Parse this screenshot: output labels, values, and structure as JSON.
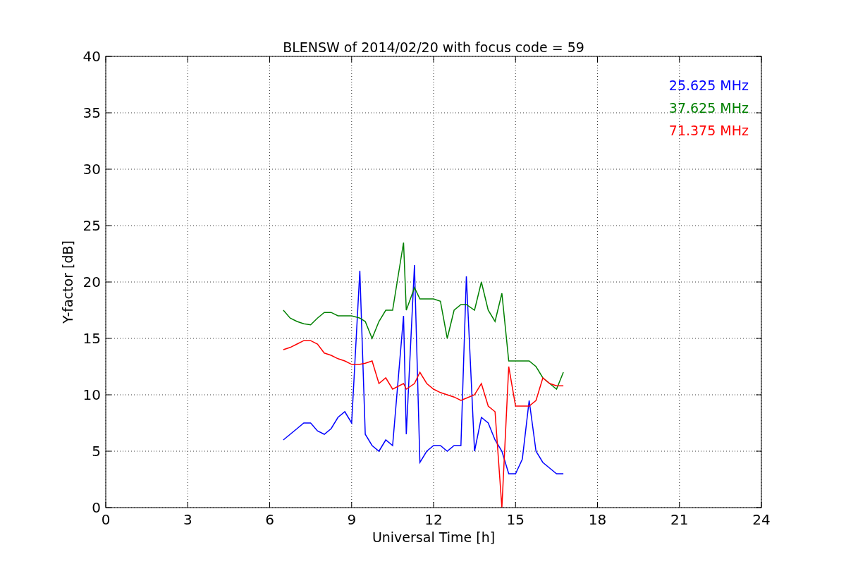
{
  "chart_data": {
    "type": "line",
    "title": "BLENSW of 2014/02/20 with focus code = 59",
    "xlabel": "Universal Time [h]",
    "ylabel": "Y-factor [dB]",
    "x": [
      6.5,
      6.75,
      7,
      7.25,
      7.5,
      7.75,
      8,
      8.25,
      8.5,
      8.75,
      9,
      9.3,
      9.5,
      9.75,
      10,
      10.25,
      10.5,
      10.9,
      11,
      11.3,
      11.5,
      11.75,
      12,
      12.25,
      12.5,
      12.75,
      13,
      13.2,
      13.5,
      13.75,
      14,
      14.25,
      14.5,
      14.75,
      15,
      15.25,
      15.5,
      15.75,
      16,
      16.25,
      16.5,
      16.75
    ],
    "series": [
      {
        "name": "25.625 MHz",
        "color": "#0000ff",
        "values": [
          6,
          6.5,
          7,
          7.5,
          7.5,
          6.8,
          6.5,
          7,
          8,
          8.5,
          7.5,
          21,
          6.5,
          5.5,
          5,
          6,
          5.5,
          17,
          6.5,
          21.5,
          4,
          5,
          5.5,
          5.5,
          5,
          5.5,
          5.5,
          20.5,
          5,
          8,
          7.5,
          6,
          5,
          3,
          3,
          4.3,
          9.5,
          5,
          4,
          3.5,
          3,
          3
        ]
      },
      {
        "name": "37.625 MHz",
        "color": "#008000",
        "values": [
          17.5,
          16.8,
          16.5,
          16.3,
          16.2,
          16.8,
          17.3,
          17.3,
          17,
          17,
          17,
          16.8,
          16.5,
          15,
          16.5,
          17.5,
          17.5,
          23.5,
          17.5,
          19.5,
          18.5,
          18.5,
          18.5,
          18.3,
          15,
          17.5,
          18,
          18,
          17.5,
          20,
          17.5,
          16.5,
          19,
          13,
          13,
          13,
          13,
          12.5,
          11.5,
          11,
          10.5,
          12
        ]
      },
      {
        "name": "71.375 MHz",
        "color": "#ff0000",
        "values": [
          14,
          14.2,
          14.5,
          14.8,
          14.8,
          14.5,
          13.7,
          13.5,
          13.2,
          13,
          12.7,
          12.7,
          12.8,
          13,
          11,
          11.5,
          10.5,
          11,
          10.5,
          11,
          12,
          11,
          10.5,
          10.2,
          10,
          9.8,
          9.5,
          9.7,
          10,
          11,
          9,
          8.5,
          0,
          12.5,
          9,
          9,
          9,
          9.5,
          11.5,
          11,
          10.8,
          10.8
        ]
      }
    ],
    "grid": true,
    "xlim": [
      0,
      24
    ],
    "ylim": [
      0,
      40
    ],
    "xticks": [
      0,
      3,
      6,
      9,
      12,
      15,
      18,
      21,
      24
    ],
    "yticks": [
      0,
      5,
      10,
      15,
      20,
      25,
      30,
      35,
      40
    ]
  }
}
